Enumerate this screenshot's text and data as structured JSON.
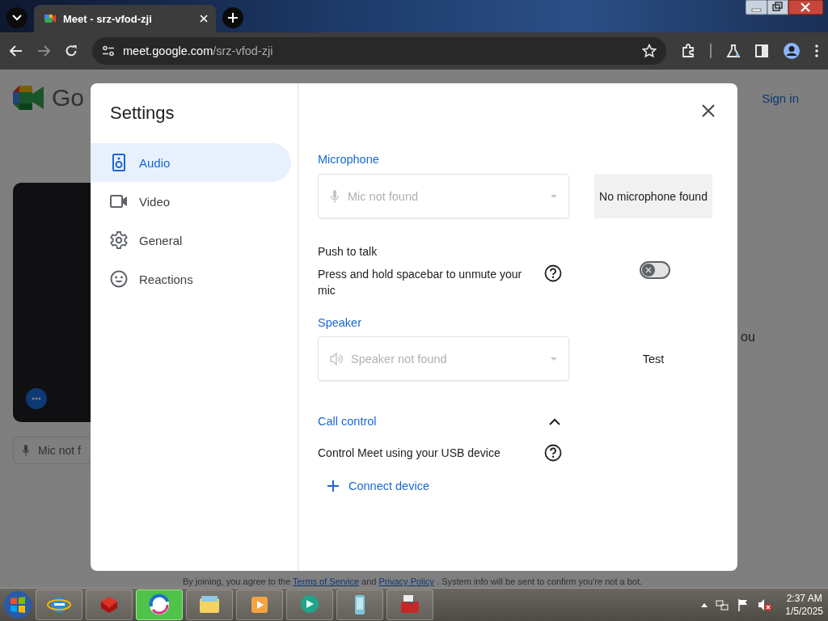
{
  "browser": {
    "tab": {
      "title": "Meet - srz-vfod-zji"
    },
    "url": {
      "host": "meet.google.com",
      "path": "/srz-vfod-zji"
    }
  },
  "page": {
    "logo_text": "Go",
    "sign_in": "Sign in",
    "preview_field": "Mic not f",
    "side_text": "ou",
    "footer": [
      {
        "kind": "text",
        "text": "By joining, you agree to the"
      },
      {
        "kind": "link",
        "text": "Terms of Service"
      },
      {
        "kind": "text",
        "text": "and"
      },
      {
        "kind": "link",
        "text": "Privacy Policy"
      },
      {
        "kind": "text",
        "text": ". System info will be sent to confirm you're not a bot."
      }
    ]
  },
  "dialog": {
    "title": "Settings",
    "nav": [
      {
        "label": "Audio",
        "kind": "speaker",
        "selected": true
      },
      {
        "label": "Video",
        "kind": "camera",
        "selected": false
      },
      {
        "label": "General",
        "kind": "gear",
        "selected": false
      },
      {
        "label": "Reactions",
        "kind": "smiley",
        "selected": false
      }
    ],
    "microphone": {
      "heading": "Microphone",
      "placeholder": "Mic not found",
      "status": "No microphone found"
    },
    "push_to_talk": {
      "title": "Push to talk",
      "description": "Press and hold spacebar to unmute your mic",
      "on": false
    },
    "speaker": {
      "heading": "Speaker",
      "placeholder": "Speaker not found",
      "test_button": "Test"
    },
    "call_control": {
      "heading": "Call control",
      "expanded": true,
      "description": "Control Meet using your USB device",
      "connect_button": "Connect device"
    }
  },
  "taskbar": {
    "apps": [
      {
        "kind": "browser-e",
        "selected": false
      },
      {
        "kind": "red-box",
        "selected": false
      },
      {
        "kind": "swirl",
        "selected": true
      },
      {
        "kind": "folder",
        "selected": false
      },
      {
        "kind": "media",
        "selected": false
      },
      {
        "kind": "chat",
        "selected": false
      },
      {
        "kind": "phone",
        "selected": false
      },
      {
        "kind": "toolbox",
        "selected": false
      }
    ],
    "time": "2:37 AM",
    "date": "1/5/2025"
  }
}
